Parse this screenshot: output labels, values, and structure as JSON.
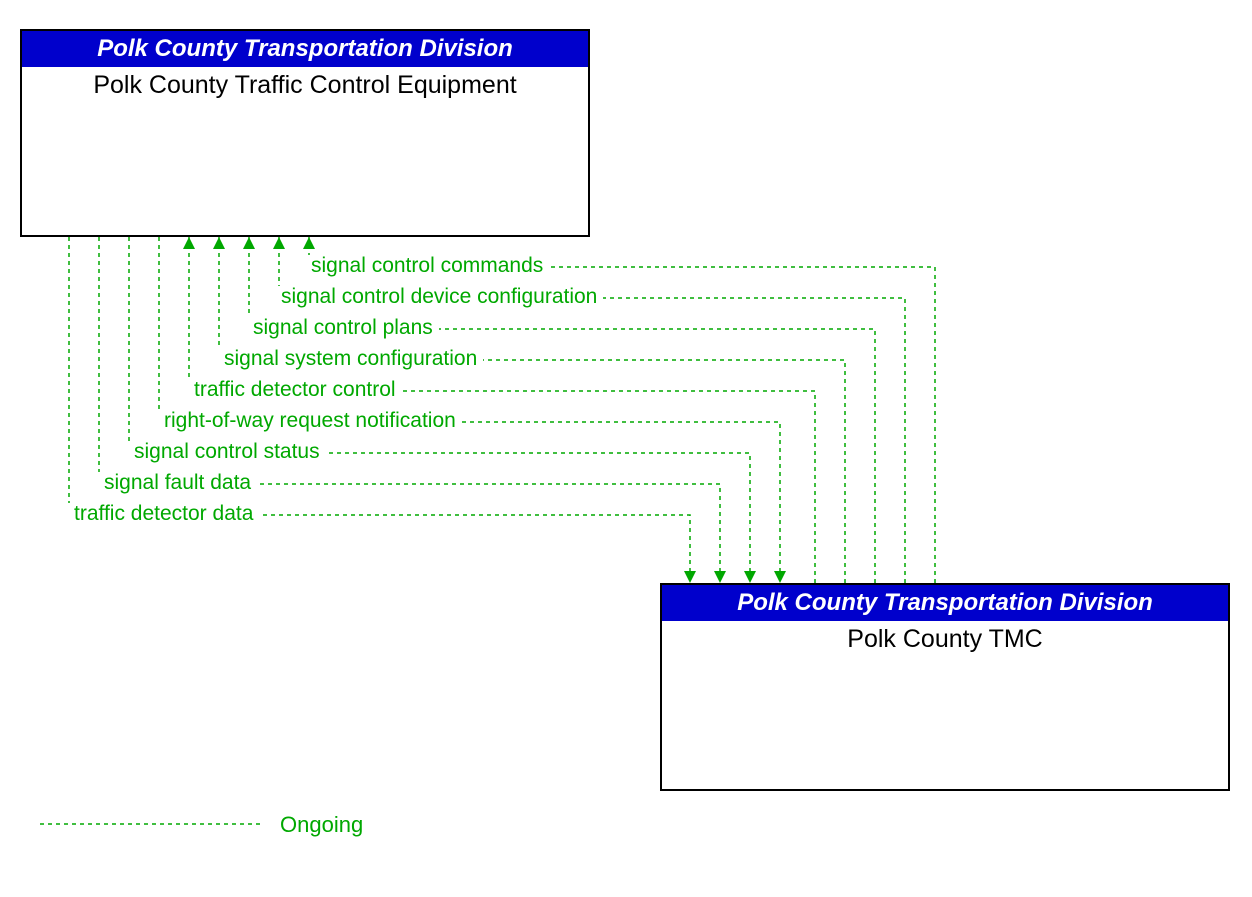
{
  "boxes": {
    "top": {
      "header": "Polk County Transportation Division",
      "title": "Polk County Traffic Control Equipment"
    },
    "bottom": {
      "header": "Polk County Transportation Division",
      "title": "Polk County TMC"
    }
  },
  "flows": {
    "to_top": [
      "signal control commands",
      "signal control device configuration",
      "signal control plans",
      "signal system configuration",
      "traffic detector control"
    ],
    "to_bottom": [
      "right-of-way request notification",
      "signal control status",
      "signal fault data",
      "traffic detector data"
    ]
  },
  "legend": {
    "label": "Ongoing"
  },
  "colors": {
    "flow": "#00a800",
    "header_bg": "#0000cc"
  }
}
